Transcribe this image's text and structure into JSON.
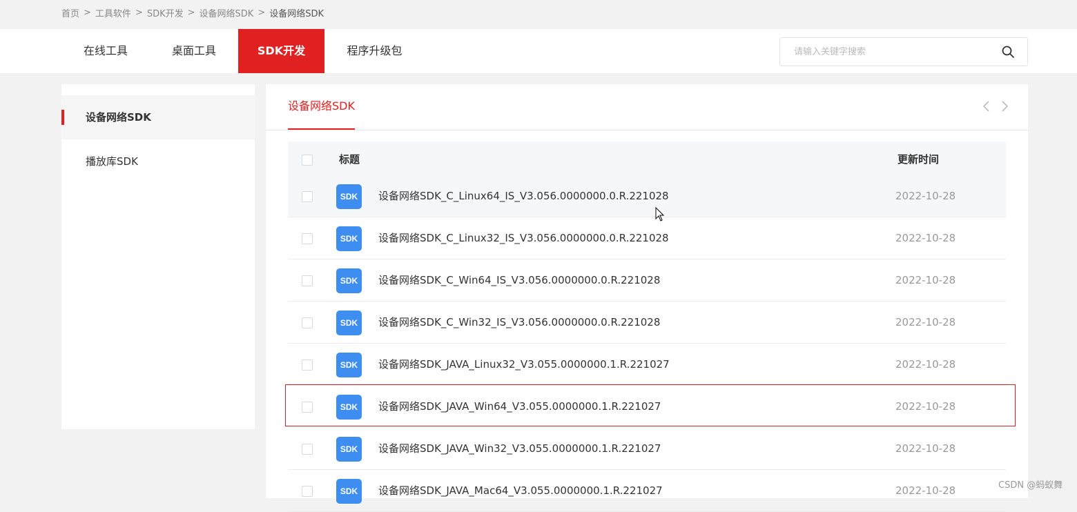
{
  "breadcrumb": {
    "items": [
      "首页",
      "工具软件",
      "SDK开发",
      "设备网络SDK",
      "设备网络SDK"
    ],
    "separator": ">"
  },
  "nav": {
    "tabs": [
      "在线工具",
      "桌面工具",
      "SDK开发",
      "程序升级包"
    ],
    "active_tab": "SDK开发"
  },
  "search": {
    "placeholder": "请输入关键字搜索",
    "icon": "search-icon"
  },
  "sidebar": {
    "items": [
      "设备网络SDK",
      "播放库SDK"
    ],
    "active_item": "设备网络SDK"
  },
  "main": {
    "title": "设备网络SDK",
    "prev_icon": "chevron-left-icon",
    "next_icon": "chevron-right-icon"
  },
  "table": {
    "headers": {
      "title": "标题",
      "updated": "更新时间"
    },
    "badge_label": "SDK",
    "rows": [
      {
        "title": "设备网络SDK_C_Linux64_IS_V3.056.0000000.0.R.221028",
        "date": "2022-10-28"
      },
      {
        "title": "设备网络SDK_C_Linux32_IS_V3.056.0000000.0.R.221028",
        "date": "2022-10-28"
      },
      {
        "title": "设备网络SDK_C_Win64_IS_V3.056.0000000.0.R.221028",
        "date": "2022-10-28"
      },
      {
        "title": "设备网络SDK_C_Win32_IS_V3.056.0000000.0.R.221028",
        "date": "2022-10-28"
      },
      {
        "title": "设备网络SDK_JAVA_Linux32_V3.055.0000000.1.R.221027",
        "date": "2022-10-28"
      },
      {
        "title": "设备网络SDK_JAVA_Win64_V3.055.0000000.1.R.221027",
        "date": "2022-10-28"
      },
      {
        "title": "设备网络SDK_JAVA_Win32_V3.055.0000000.1.R.221027",
        "date": "2022-10-28"
      },
      {
        "title": "设备网络SDK_JAVA_Mac64_V3.055.0000000.1.R.221027",
        "date": "2022-10-28"
      }
    ]
  },
  "colors": {
    "accent": "#e02021",
    "badge": "#3d8ef0",
    "highlight": "#c9252c"
  },
  "watermark": "CSDN @蚂蚁舞"
}
